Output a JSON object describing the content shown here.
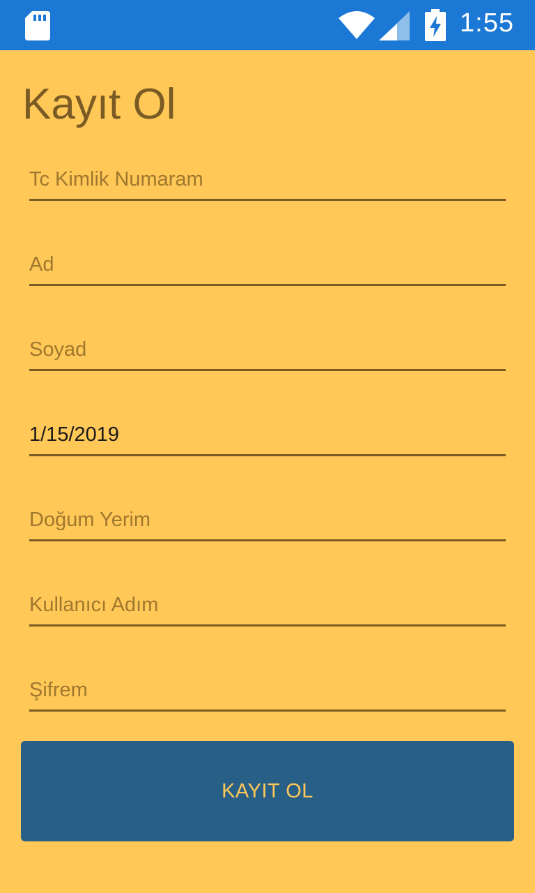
{
  "status_bar": {
    "time": "1:55",
    "icons": [
      "sd-card-icon",
      "wifi-icon",
      "signal-icon",
      "battery-charging-icon"
    ],
    "background_color": "#1C78D5"
  },
  "page": {
    "title": "Kayıt Ol",
    "background_color": "#FFC857",
    "accent_color": "#7A5B24"
  },
  "form": {
    "tc_kimlik": {
      "placeholder": "Tc Kimlik Numaram",
      "value": ""
    },
    "ad": {
      "placeholder": "Ad",
      "value": ""
    },
    "soyad": {
      "placeholder": "Soyad",
      "value": ""
    },
    "dogum_tarihi": {
      "placeholder": "",
      "value": "1/15/2019"
    },
    "dogum_yeri": {
      "placeholder": "Doğum Yerim",
      "value": ""
    },
    "kullanici_adi": {
      "placeholder": "Kullanıcı Adım",
      "value": ""
    },
    "sifre": {
      "placeholder": "Şifrem",
      "value": ""
    }
  },
  "button": {
    "label": "KAYIT OL",
    "background_color": "#275F87",
    "text_color": "#FFC857"
  }
}
